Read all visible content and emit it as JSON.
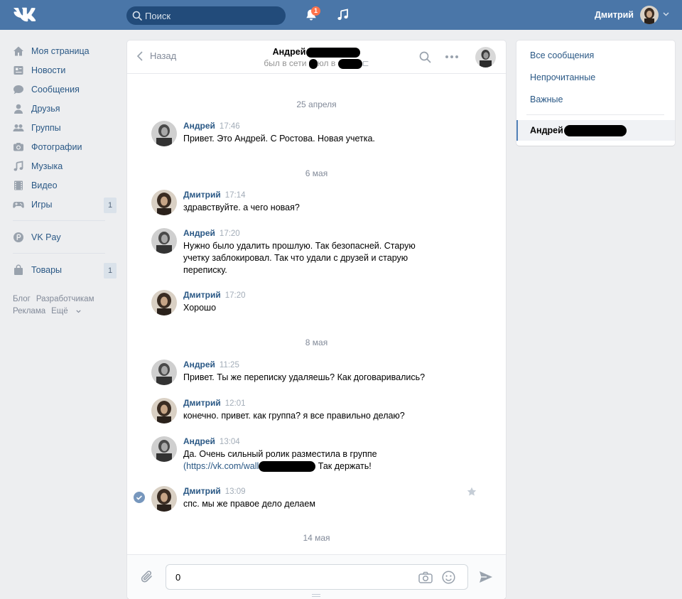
{
  "header": {
    "search_placeholder": "Поиск",
    "notifications_count": "1",
    "user_name": "Дмитрий"
  },
  "sidebar": {
    "items": [
      {
        "label": "Моя страница",
        "icon": "home-icon"
      },
      {
        "label": "Новости",
        "icon": "news-icon"
      },
      {
        "label": "Сообщения",
        "icon": "messages-icon"
      },
      {
        "label": "Друзья",
        "icon": "friends-icon"
      },
      {
        "label": "Группы",
        "icon": "groups-icon"
      },
      {
        "label": "Фотографии",
        "icon": "photos-icon"
      },
      {
        "label": "Музыка",
        "icon": "music-icon"
      },
      {
        "label": "Видео",
        "icon": "video-icon"
      },
      {
        "label": "Игры",
        "icon": "games-icon",
        "count": "1"
      },
      {
        "label": "VK Pay",
        "icon": "vkpay-icon"
      },
      {
        "label": "Товары",
        "icon": "goods-icon",
        "count": "1"
      }
    ],
    "footer": [
      "Блог",
      "Разработчикам",
      "Реклама",
      "Ещё"
    ]
  },
  "chat": {
    "back_label": "Назад",
    "peer_name": "Андрей",
    "peer_status_prefix": "был в сети",
    "peer_status_mid": "юл в",
    "dates": [
      "25 апреля",
      "6 мая",
      "8 мая",
      "14 мая"
    ],
    "messages": [
      {
        "author": "Андрей",
        "time": "17:46",
        "text": "Привет. Это Андрей. С Ростова. Новая учетка."
      },
      {
        "author": "Дмитрий",
        "time": "17:14",
        "text": "здравствуйте. а чего новая?"
      },
      {
        "author": "Андрей",
        "time": "17:20",
        "text": "Нужно было удалить прошлую. Так безопасней. Старую учетку заблокировал. Так что удали с друзей и старую переписку."
      },
      {
        "author": "Дмитрий",
        "time": "17:20",
        "text": "Хорошо"
      },
      {
        "author": "Андрей",
        "time": "11:25",
        "text": "Привет. Ты же переписку удаляешь? Как договаривались?"
      },
      {
        "author": "Дмитрий",
        "time": "12:01",
        "text": "конечно. привет. как группа? я все правильно делаю?"
      },
      {
        "author": "Андрей",
        "time": "13:04",
        "text_line1": "Да. Очень сильный ролик разместила в группе",
        "link": "(https://vk.com/wall",
        "text_tail": "Так держать!"
      },
      {
        "author": "Дмитрий",
        "time": "13:09",
        "text": "спс. мы же правое дело делаем"
      }
    ],
    "input_value": "0"
  },
  "right_menu": {
    "items": [
      "Все сообщения",
      "Непрочитанные",
      "Важные"
    ],
    "active_dialog": "Андрей"
  },
  "colors": {
    "header_bg": "#4a76a8",
    "link": "#2a5885",
    "page_bg": "#edeef0"
  }
}
